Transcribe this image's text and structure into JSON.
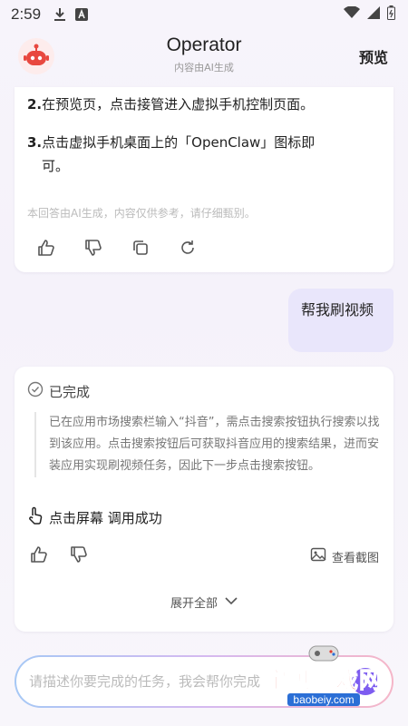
{
  "status_bar": {
    "time": "2:59"
  },
  "header": {
    "title": "Operator",
    "subtitle": "内容由AI生成",
    "preview_label": "预览"
  },
  "reply_card": {
    "steps": [
      {
        "num": "2.",
        "text": "在预览页，点击接管进入虚拟手机控制页面。"
      },
      {
        "num": "3.",
        "text": "点击虚拟手机桌面上的「OpenClaw」图标即可。"
      }
    ],
    "step3_line1": "点击虚拟手机桌面上的「OpenClaw」图标即",
    "step3_line2": "可。",
    "disclaimer": "本回答由AI生成，内容仅供参考，请仔细甄别。"
  },
  "user_message": "帮我刷视频",
  "task_card": {
    "status": "已完成",
    "reasoning": "已在应用市场搜索栏输入“抖音”，需点击搜索按钮执行搜索以找到该应用。点击搜索按钮后可获取抖音应用的搜索结果，进而安装应用实现刷视频任务，因此下一步点击搜索按钮。",
    "action_label": "点击屏幕 调用成功",
    "view_screenshot": "查看截图",
    "expand_all": "展开全部"
  },
  "input": {
    "placeholder": "请描述你要完成的任务，我会帮你完成"
  },
  "watermark": {
    "main": "宝贝游戏网",
    "sub": "baobeiy.com"
  },
  "colors": {
    "accent": "#7d5cf0",
    "bubble": "#e9e6fb",
    "watermark_red": "#e03a2f"
  }
}
